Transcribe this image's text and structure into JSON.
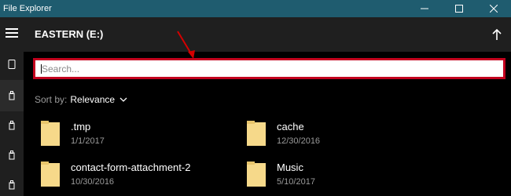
{
  "app": {
    "title": "File Explorer"
  },
  "header": {
    "location": "EASTERN (E:)"
  },
  "search": {
    "placeholder": "Search..."
  },
  "sort": {
    "label": "Sort by:",
    "value": "Relevance"
  },
  "items": [
    {
      "name": ".tmp",
      "date": "1/1/2017",
      "type": "folder"
    },
    {
      "name": "cache",
      "date": "12/30/2016",
      "type": "folder"
    },
    {
      "name": "contact-form-attachment-2",
      "date": "10/30/2016",
      "type": "folder"
    },
    {
      "name": "Music",
      "date": "5/10/2017",
      "type": "folder"
    }
  ],
  "colors": {
    "titlebar": "#1f5c6f",
    "search_border": "#c3001e",
    "folder": "#f6d98a",
    "annotation_arrow": "#d40000"
  },
  "icons": {
    "menu": "hamburger-icon",
    "up": "arrow-up-icon",
    "folder": "folder-icon"
  }
}
